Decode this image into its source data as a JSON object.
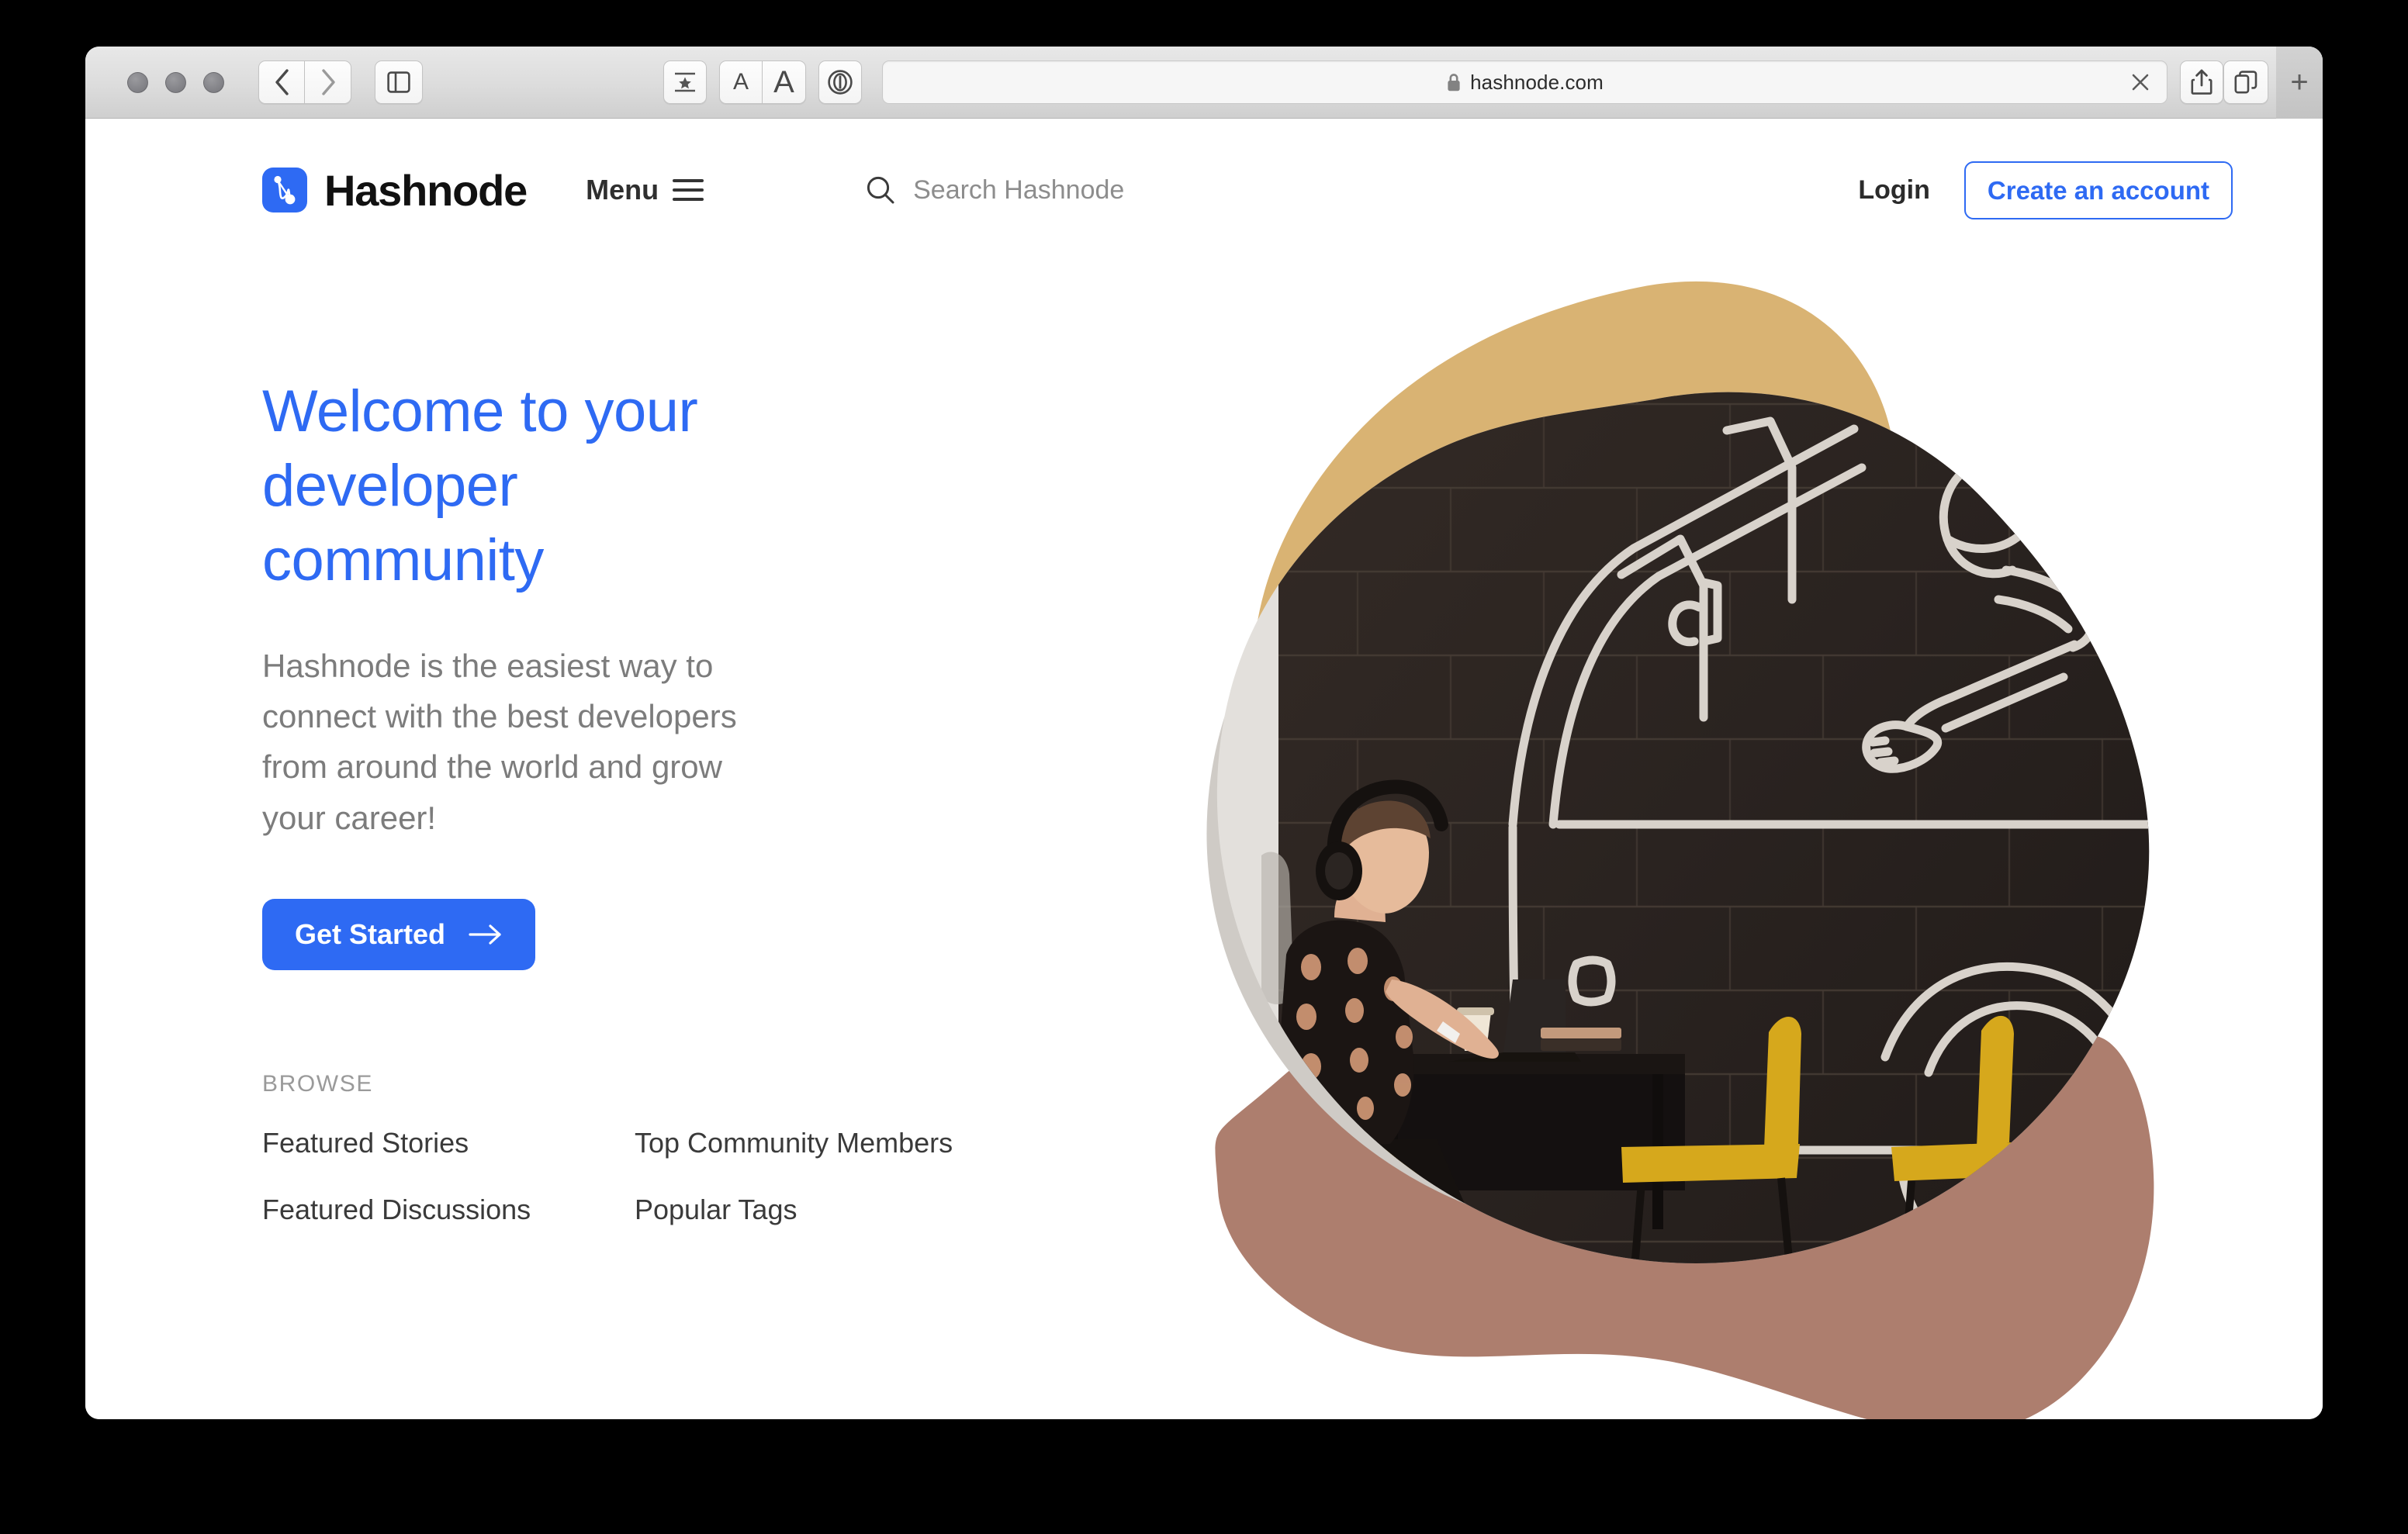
{
  "browser": {
    "url_text": "hashnode.com",
    "lock_icon": "lock-icon",
    "back_icon": "chevron-left-icon",
    "forward_icon": "chevron-right-icon",
    "sidebar_icon": "sidebar-icon",
    "reader_icon": "reader-star-icon",
    "font_smaller_icon": "font-smaller-icon",
    "font_larger_icon": "font-larger-icon",
    "privacy_icon": "privacy-report-icon",
    "stop_icon": "close-icon",
    "share_icon": "share-icon",
    "tabs_icon": "tab-overview-icon",
    "new_tab_icon": "plus-icon"
  },
  "site": {
    "brand_name": "Hashnode",
    "logo_icon": "hashnode-logo-icon",
    "menu_label": "Menu",
    "menu_icon": "hamburger-icon",
    "search": {
      "icon": "search-icon",
      "placeholder": "Search Hashnode"
    },
    "login_label": "Login",
    "signup_label": "Create an account"
  },
  "hero": {
    "title": "Welcome to your developer community",
    "subtitle": "Hashnode is the easiest way to connect with the best developers from around the world and grow your career!",
    "cta_label": "Get Started",
    "cta_icon": "arrow-right-icon"
  },
  "browse": {
    "heading": "BROWSE",
    "links": [
      {
        "label": "Featured Stories"
      },
      {
        "label": "Top Community Members"
      },
      {
        "label": "Featured Discussions"
      },
      {
        "label": "Popular Tags"
      }
    ]
  },
  "colors": {
    "accent_blue": "#2e6af3",
    "blob_gold": "#d9b373",
    "blob_rose": "#ad7e6e",
    "blob_gray": "#cfcbc6",
    "wall_dark": "#2a2320",
    "chair_yellow": "#d6a81c",
    "body_text": "#7c7c7c"
  }
}
